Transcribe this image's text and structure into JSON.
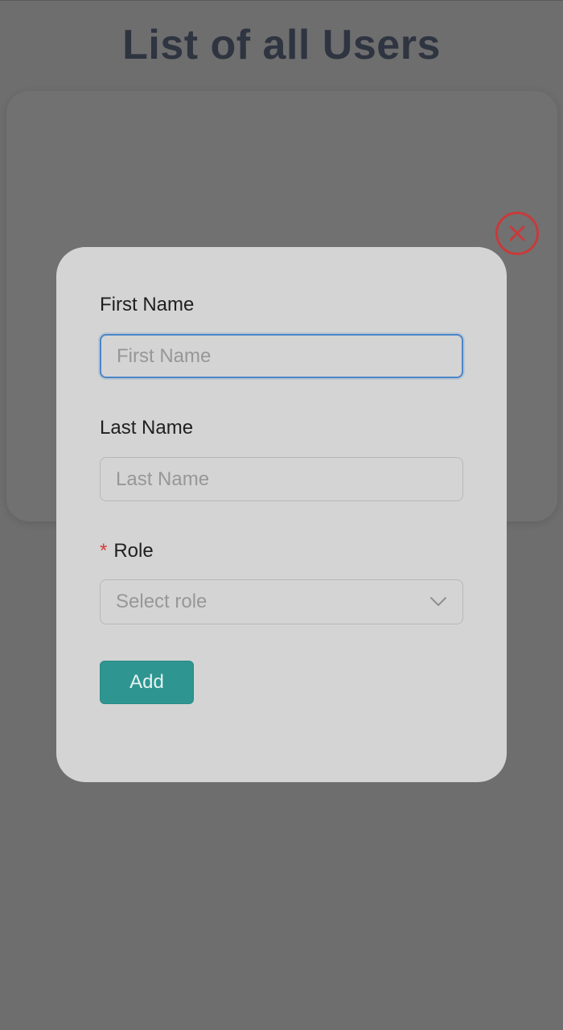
{
  "page": {
    "title": "List of all Users"
  },
  "modal": {
    "first_name": {
      "label": "First Name",
      "placeholder": "First Name",
      "value": ""
    },
    "last_name": {
      "label": "Last Name",
      "placeholder": "Last Name",
      "value": ""
    },
    "role": {
      "required_mark": "*",
      "label": "Role",
      "placeholder": "Select role"
    },
    "add_label": "Add"
  },
  "icons": {
    "close": "close-icon",
    "dropdown": "chevron-down-icon"
  },
  "colors": {
    "overlay_background": "#6e6e6e",
    "modal_background": "#d4d4d4",
    "primary_button": "#2f9590",
    "close_icon": "#c83a3a",
    "required_mark": "#d43b3b",
    "focus_border": "#4b86c8"
  }
}
